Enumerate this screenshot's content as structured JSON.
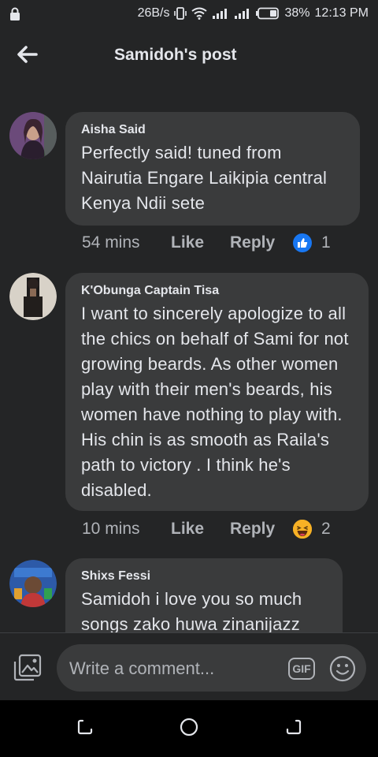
{
  "status_bar": {
    "speed": "26B/s",
    "battery": "38%",
    "time": "12:13 PM"
  },
  "header": {
    "title": "Samidoh's post"
  },
  "comments": [
    {
      "author": "Aisha Said",
      "text": "Perfectly said! tuned from Nairutia Engare Laikipia central Kenya Ndii sete",
      "time": "54 mins",
      "like_label": "Like",
      "reply_label": "Reply",
      "reaction": "like-reaction-icon",
      "reaction_count": "1"
    },
    {
      "author": "K'Obunga Captain Tisa",
      "text": "I want to sincerely apologize to all the chics on behalf of Sami for not growing beards. As other women play with their men's beards, his women have nothing to play with. His chin is as smooth as Raila's path to victory . I think he's disabled.",
      "time": "10 mins",
      "like_label": "Like",
      "reply_label": "Reply",
      "reaction": "haha-reaction-icon",
      "reaction_count": "2"
    },
    {
      "author": "Shixs Fessi",
      "text": "Samidoh i love you so much songs zako huwa zinanijazz"
    }
  ],
  "composer": {
    "placeholder": "Write a comment...",
    "gif_label": "GIF"
  },
  "colors": {
    "background": "#242526",
    "bubble": "#3a3b3c",
    "text": "#e4e6eb",
    "secondary_text": "#b0b3b8",
    "like_blue": "#1877f2"
  }
}
